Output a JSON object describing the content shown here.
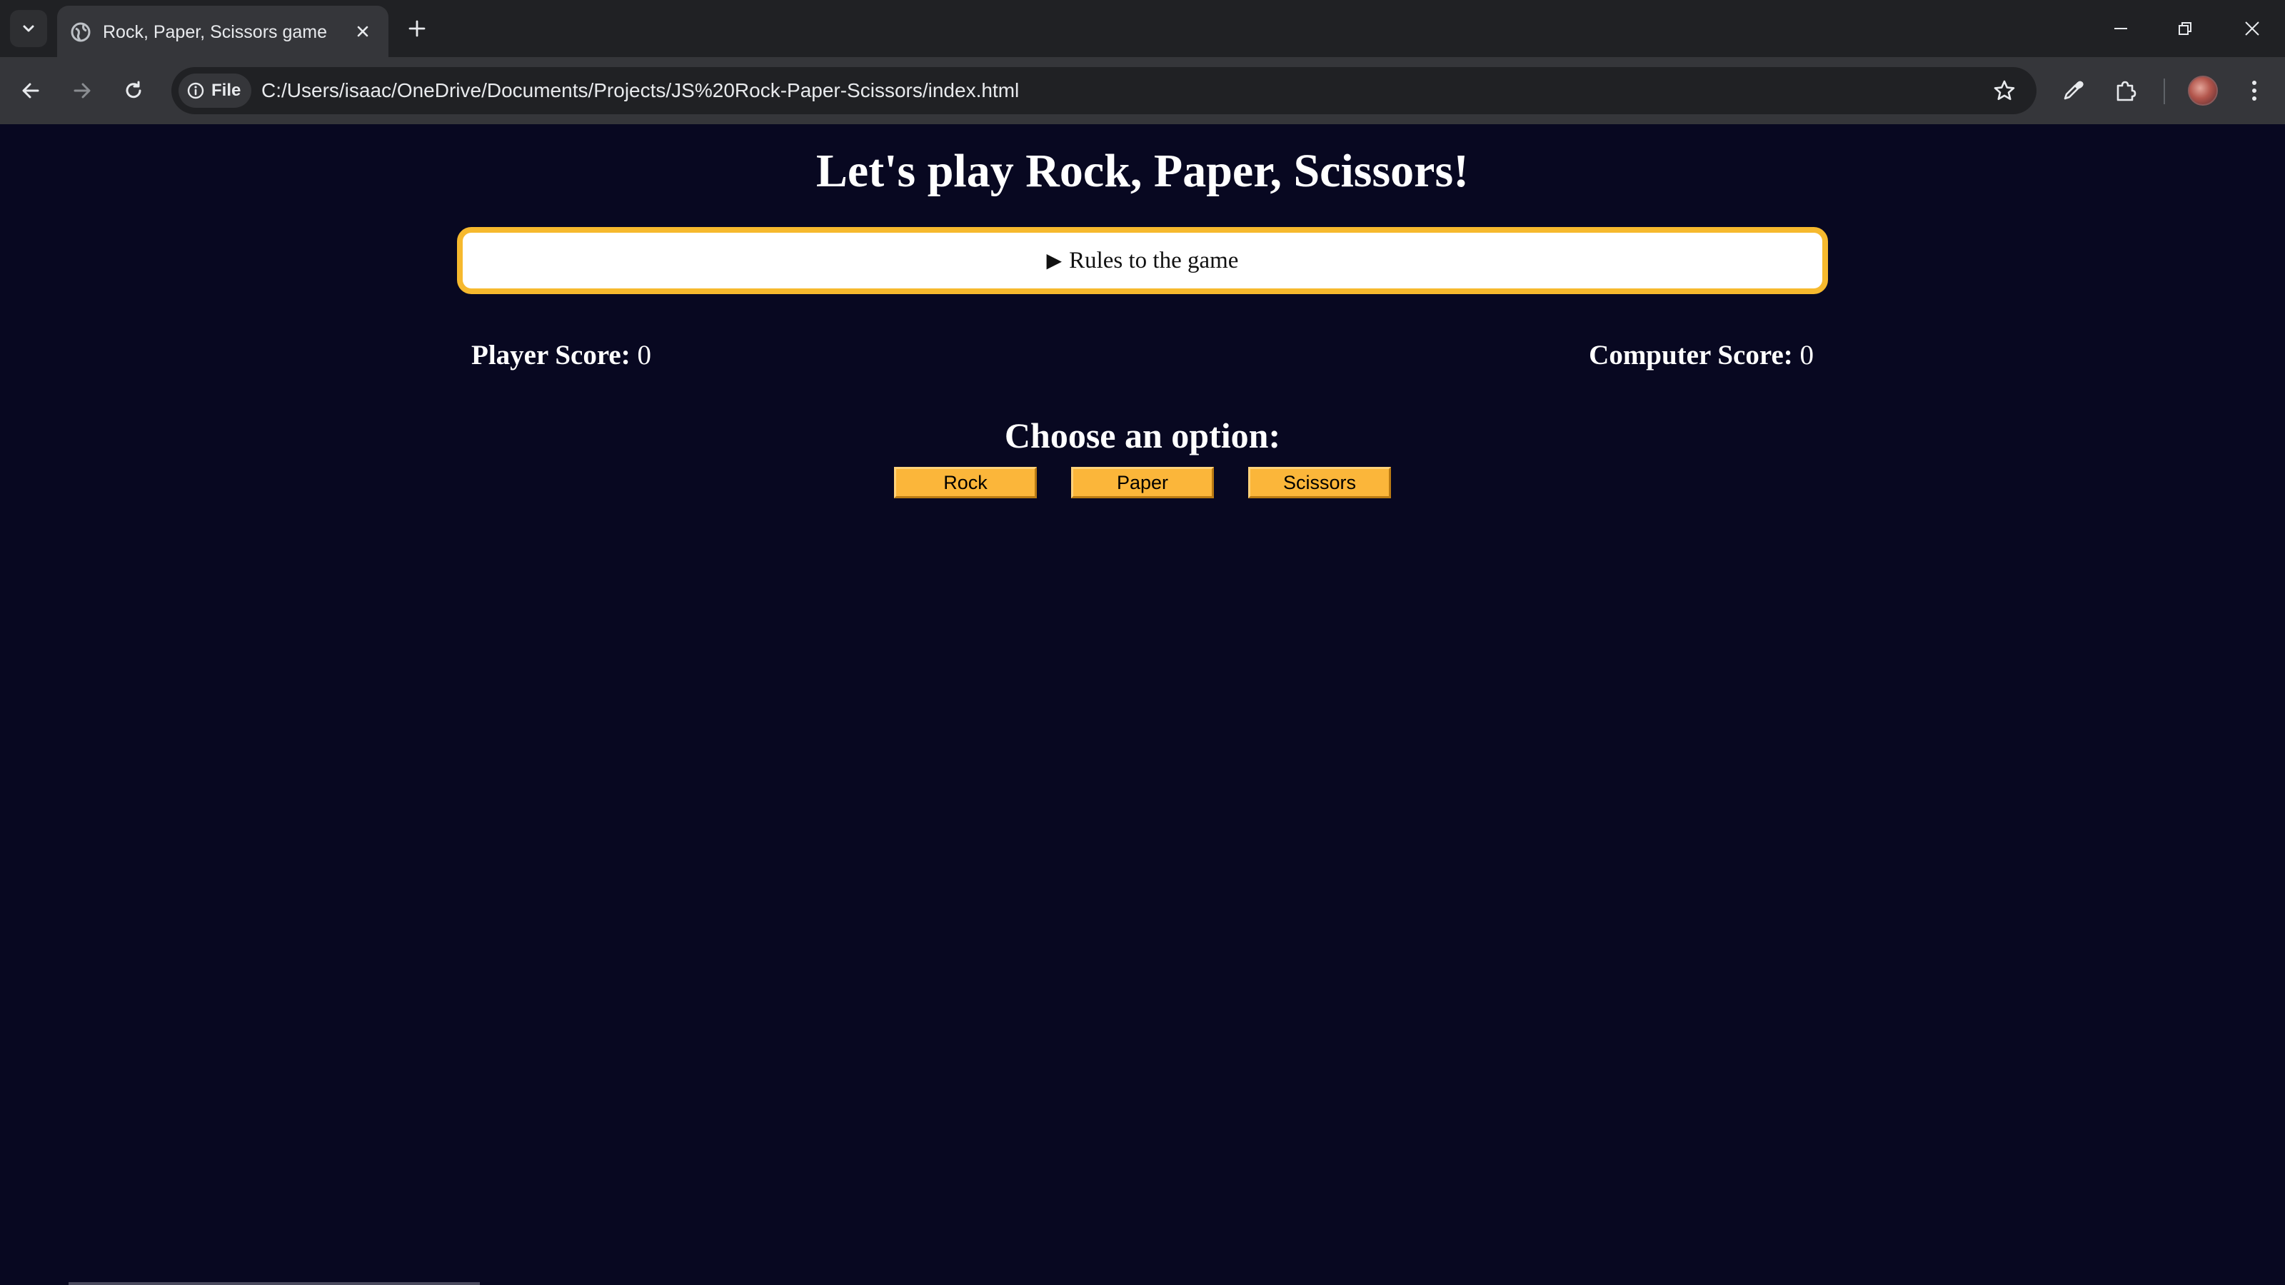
{
  "browser": {
    "tab_title": "Rock, Paper, Scissors game",
    "site_chip_label": "File",
    "url": "C:/Users/isaac/OneDrive/Documents/Projects/JS%20Rock-Paper-Scissors/index.html"
  },
  "page": {
    "title": "Let's play Rock, Paper, Scissors!",
    "rules_label": "Rules to the game",
    "player_score_label": "Player Score:",
    "player_score_value": "0",
    "computer_score_label": "Computer Score:",
    "computer_score_value": "0",
    "choose_heading": "Choose an option:",
    "options": [
      "Rock",
      "Paper",
      "Scissors"
    ]
  },
  "colors": {
    "page_background": "#080821",
    "accent": "#f6b92e",
    "button_fill": "#fbb63a"
  },
  "icons": {
    "tab_search": "chevron-down-icon",
    "favicon": "globe-icon",
    "tab_close": "close-icon",
    "new_tab": "plus-icon",
    "minimize": "minimize-icon",
    "restore": "restore-icon",
    "close_window": "close-icon",
    "back": "back-arrow-icon",
    "forward": "forward-arrow-icon",
    "reload": "reload-icon",
    "site_info": "info-icon",
    "bookmark": "star-icon",
    "eyedropper": "eyedropper-icon",
    "extensions": "puzzle-icon",
    "menu": "kebab-menu-icon",
    "disclosure": "triangle-right-icon"
  }
}
